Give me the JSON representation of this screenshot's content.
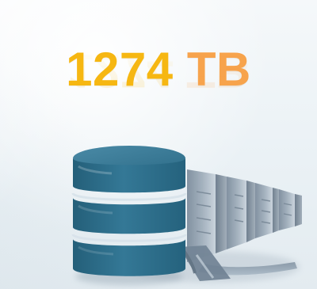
{
  "metric": {
    "number": "1274",
    "unit": "TB"
  },
  "icons": {
    "storage": "database-icon",
    "server": "server-rack-icon"
  },
  "colors": {
    "number": "#f6b712",
    "unit": "#f7a34c",
    "database": "#2f6e8a",
    "server": "#8a98a8",
    "background": "#eef3f6"
  }
}
